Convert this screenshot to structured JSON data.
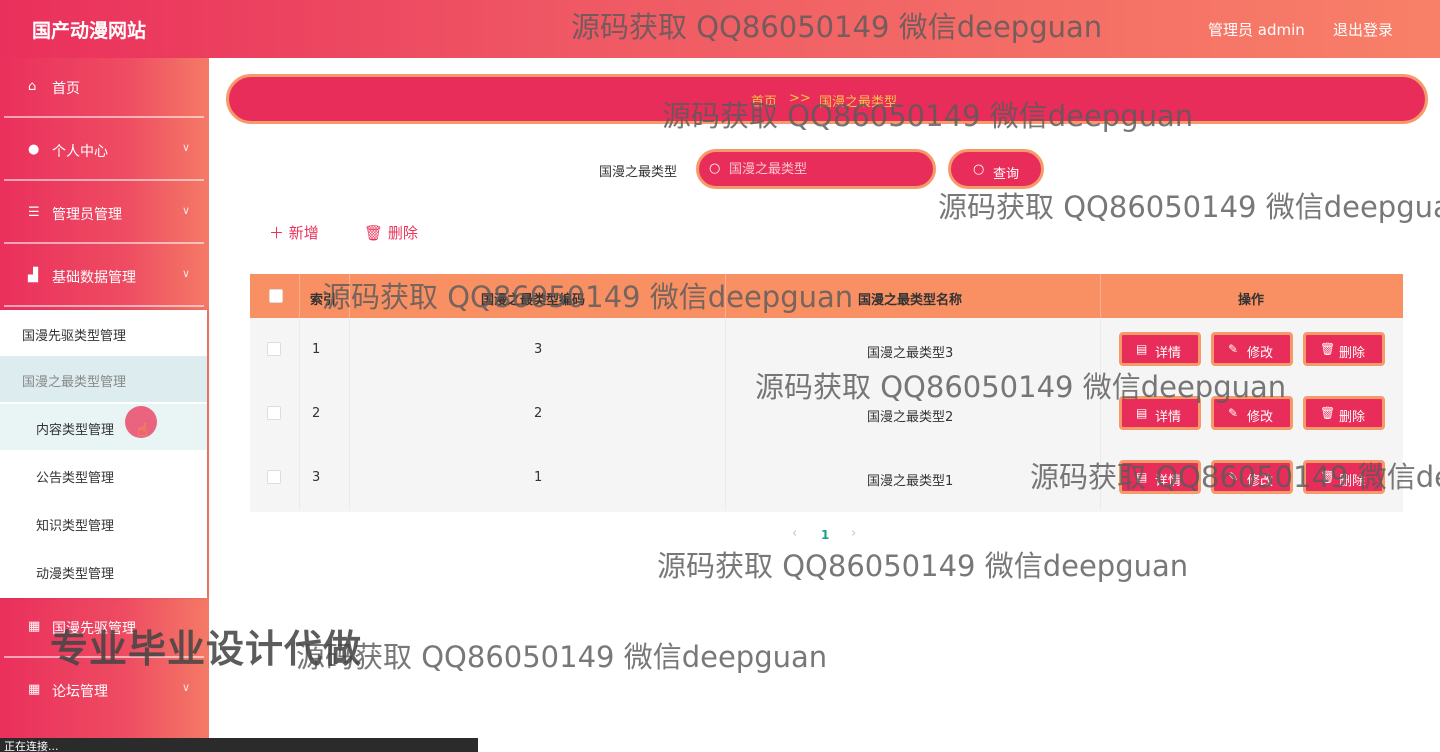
{
  "header": {
    "brand": "国产动漫网站",
    "user_label": "管理员 admin",
    "logout": "退出登录"
  },
  "sidebar": {
    "items": [
      {
        "label": "首页",
        "icon": "home-icon",
        "has_arrow": false
      },
      {
        "label": "个人中心",
        "icon": "user-icon",
        "has_arrow": true
      },
      {
        "label": "管理员管理",
        "icon": "list-icon",
        "has_arrow": true
      },
      {
        "label": "基础数据管理",
        "icon": "chart-icon",
        "has_arrow": true
      },
      {
        "label": "国漫先驱管理",
        "icon": "grid-icon",
        "has_arrow": false
      },
      {
        "label": "论坛管理",
        "icon": "grid-icon",
        "has_arrow": true
      }
    ],
    "submenu": [
      {
        "label": "国漫先驱类型管理",
        "state": "normal"
      },
      {
        "label": "国漫之最类型管理",
        "state": "active"
      },
      {
        "label": "内容类型管理",
        "state": "hover"
      },
      {
        "label": "公告类型管理",
        "state": "normal"
      },
      {
        "label": "知识类型管理",
        "state": "normal"
      },
      {
        "label": "动漫类型管理",
        "state": "normal"
      }
    ]
  },
  "breadcrumb": {
    "home": "首页",
    "separator": ">>",
    "current": "国漫之最类型"
  },
  "search": {
    "label": "国漫之最类型",
    "placeholder": "国漫之最类型",
    "button": "查询"
  },
  "actions": {
    "add": "新增",
    "delete": "删除"
  },
  "table": {
    "columns": [
      "索引",
      "国漫之最类型编码",
      "国漫之最类型名称",
      "操作"
    ],
    "rows": [
      {
        "index": "1",
        "code": "3",
        "name": "国漫之最类型3"
      },
      {
        "index": "2",
        "code": "2",
        "name": "国漫之最类型2"
      },
      {
        "index": "3",
        "code": "1",
        "name": "国漫之最类型1"
      }
    ],
    "row_actions": {
      "detail": "详情",
      "edit": "修改",
      "delete": "删除"
    }
  },
  "pagination": {
    "prev": "‹",
    "current": "1",
    "next": "›"
  },
  "watermark": {
    "text": "源码获取 QQ86050149 微信deepguan",
    "banner": "专业毕业设计代做"
  },
  "status_bar": "正在连接...",
  "colors": {
    "primary": "#e92d5a",
    "border_accent": "#f79a6a",
    "table_header": "#f99063",
    "breadcrumb_text": "#f6c44a",
    "pagination_active": "#1aa583"
  }
}
